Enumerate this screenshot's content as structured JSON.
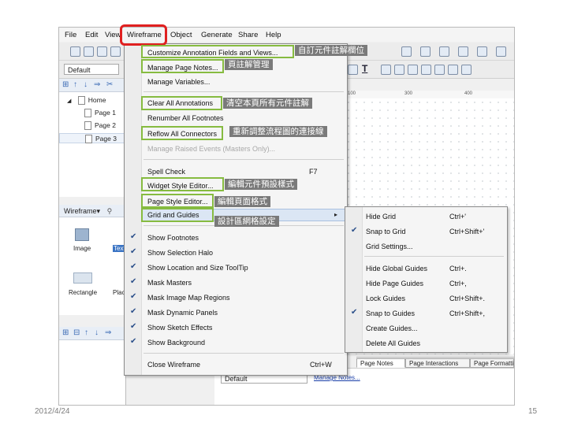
{
  "menubar": {
    "items": [
      "File",
      "Edit",
      "View",
      "Wireframe",
      "Object",
      "Generate",
      "Share",
      "Help"
    ]
  },
  "toolbar": {
    "style_combo": "Default",
    "canvas_combo": "Default"
  },
  "sitemap": {
    "pages": [
      "Home",
      "Page 1",
      "Page 2",
      "Page 3"
    ]
  },
  "widgets_panel": {
    "title": "Wireframe",
    "items": [
      "Image",
      "Text",
      "Rectangle",
      "Placeholder"
    ]
  },
  "ruler": {
    "ticks": [
      "100",
      "300",
      "400"
    ]
  },
  "wireframe_menu": {
    "customize_annotation": "Customize Annotation Fields and Views...",
    "manage_page_notes": "Manage Page Notes...",
    "manage_variables": "Manage Variables...",
    "clear_all_annotations": "Clear All Annotations",
    "renumber_footnotes": "Renumber All Footnotes",
    "reflow_connectors": "Reflow All Connectors",
    "manage_raised_events": "Manage Raised Events (Masters Only)...",
    "spell_check": "Spell Check",
    "spell_check_shortcut": "F7",
    "widget_style_editor": "Widget Style Editor...",
    "page_style_editor": "Page Style Editor...",
    "grid_and_guides": "Grid and Guides",
    "show_footnotes": "Show Footnotes",
    "show_selection_halo": "Show Selection Halo",
    "show_location_tooltip": "Show Location and Size ToolTip",
    "mask_masters": "Mask Masters",
    "mask_image_map": "Mask Image Map Regions",
    "mask_dynamic_panels": "Mask Dynamic Panels",
    "show_sketch_effects": "Show Sketch Effects",
    "show_background": "Show Background",
    "close_wireframe": "Close Wireframe",
    "close_wireframe_shortcut": "Ctrl+W"
  },
  "grid_submenu": {
    "items": [
      {
        "label": "Hide Grid",
        "shortcut": "Ctrl+'",
        "checked": false
      },
      {
        "label": "Snap to Grid",
        "shortcut": "Ctrl+Shift+'",
        "checked": true
      },
      {
        "label": "Grid Settings...",
        "shortcut": "",
        "checked": false
      },
      {
        "label": "Hide Global Guides",
        "shortcut": "Ctrl+.",
        "checked": false
      },
      {
        "label": "Hide Page Guides",
        "shortcut": "Ctrl+,",
        "checked": false
      },
      {
        "label": "Lock Guides",
        "shortcut": "Ctrl+Shift+.",
        "checked": false
      },
      {
        "label": "Snap to Guides",
        "shortcut": "Ctrl+Shift+,",
        "checked": true
      },
      {
        "label": "Create Guides...",
        "shortcut": "",
        "checked": false
      },
      {
        "label": "Delete All Guides",
        "shortcut": "",
        "checked": false
      }
    ]
  },
  "bottom_tabs": [
    "Page Notes",
    "Page Interactions",
    "Page Formatting"
  ],
  "notes_link": "Manage Notes...",
  "callouts": {
    "customize_annotation": "自訂元件註解欄位",
    "page_notes": "頁註解管理",
    "clear_annotations": "清空本頁所有元件註解",
    "reflow_connectors": "重新調整流程圖的連接線",
    "widget_style": "編輯元件預設樣式",
    "page_style": "編輯頁面格式",
    "grid": "設計區網格設定"
  },
  "footer": {
    "date": "2012/4/24",
    "page_number": "15"
  },
  "colors": {
    "highlight_green": "#86bb40",
    "wireframe_red": "#e02020",
    "callout_bg": "#7a7a7a"
  }
}
